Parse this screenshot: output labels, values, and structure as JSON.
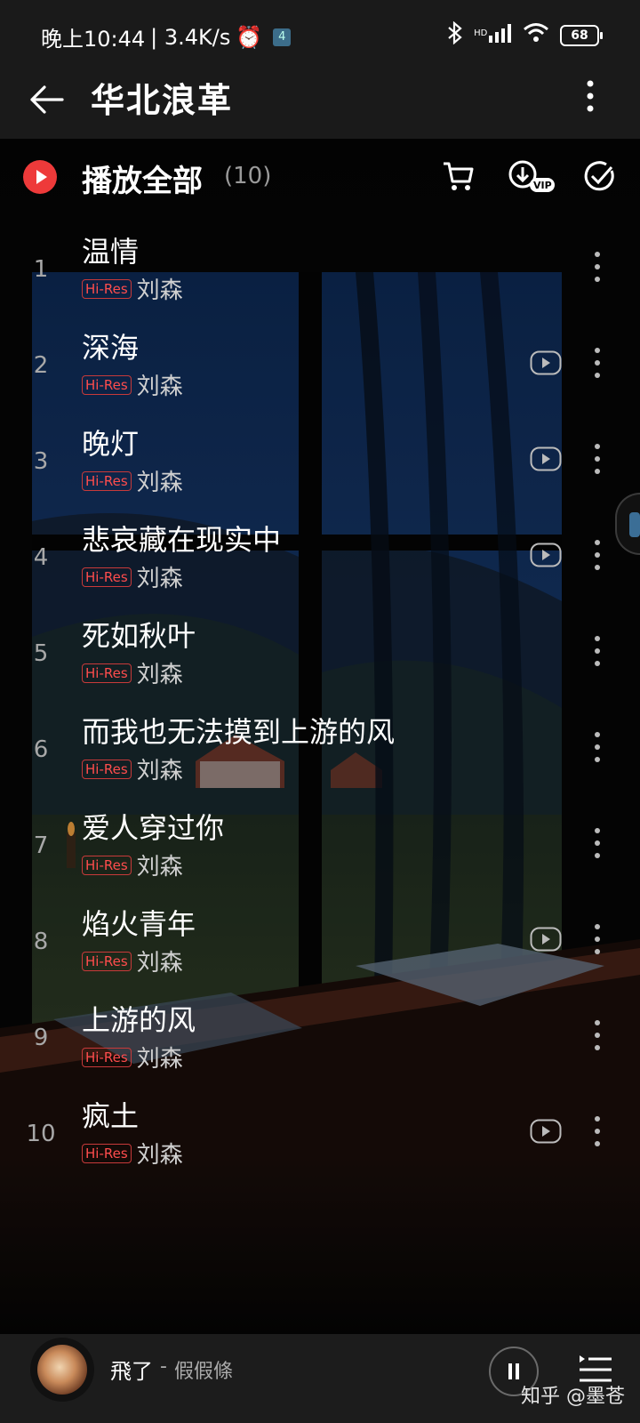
{
  "status_bar": {
    "time": "晚上10:44",
    "speed": "| 3.4K/s",
    "alarm_icon": "alarm-icon",
    "hd_label": "HD",
    "battery": "68"
  },
  "header": {
    "title": "华北浪革"
  },
  "toolbar": {
    "play_all_label": "播放全部",
    "count": "(10)",
    "vip_label": "VIP"
  },
  "songs": [
    {
      "index": "1",
      "name": "温情",
      "badge": "Hi-Res",
      "artist": "刘森",
      "has_mv": false
    },
    {
      "index": "2",
      "name": "深海",
      "badge": "Hi-Res",
      "artist": "刘森",
      "has_mv": true
    },
    {
      "index": "3",
      "name": "晚灯",
      "badge": "Hi-Res",
      "artist": "刘森",
      "has_mv": true
    },
    {
      "index": "4",
      "name": "悲哀藏在现实中",
      "badge": "Hi-Res",
      "artist": "刘森",
      "has_mv": true
    },
    {
      "index": "5",
      "name": "死如秋叶",
      "badge": "Hi-Res",
      "artist": "刘森",
      "has_mv": false
    },
    {
      "index": "6",
      "name": "而我也无法摸到上游的风",
      "badge": "Hi-Res",
      "artist": "刘森",
      "has_mv": false
    },
    {
      "index": "7",
      "name": "爱人穿过你",
      "badge": "Hi-Res",
      "artist": "刘森",
      "has_mv": false
    },
    {
      "index": "8",
      "name": "焰火青年",
      "badge": "Hi-Res",
      "artist": "刘森",
      "has_mv": true
    },
    {
      "index": "9",
      "name": "上游的风",
      "badge": "Hi-Res",
      "artist": "刘森",
      "has_mv": false
    },
    {
      "index": "10",
      "name": "疯土",
      "badge": "Hi-Res",
      "artist": "刘森",
      "has_mv": true
    }
  ],
  "now_playing": {
    "title": "飛了",
    "separator": "-",
    "artist": "假假條"
  },
  "watermark": "知乎 @墨苍",
  "colors": {
    "accent": "#ee3a3a",
    "background": "#050505",
    "bar": "#1a1a1a"
  }
}
